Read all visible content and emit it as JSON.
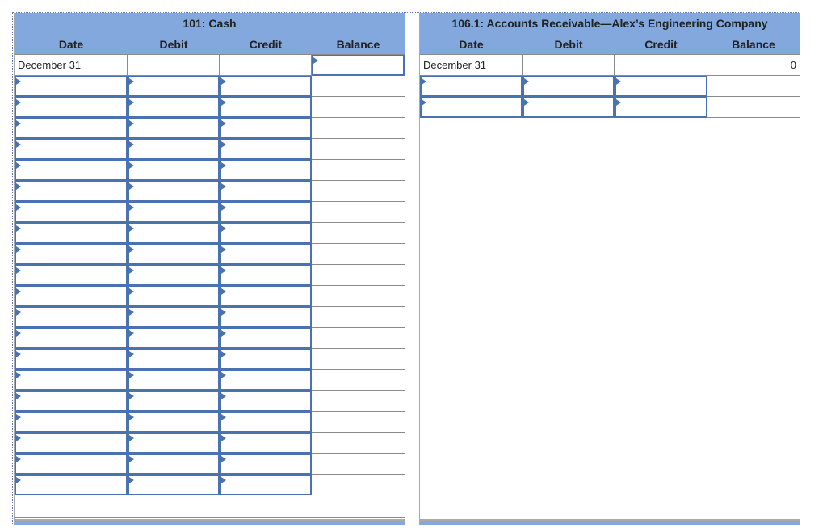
{
  "columns": [
    "Date",
    "Debit",
    "Credit",
    "Balance"
  ],
  "accent_color": "#82a8de",
  "input_border_color": "#4a72b0",
  "accounts": [
    {
      "title": "101: Cash",
      "rows": [
        {
          "values": [
            "December 31",
            "",
            "",
            ""
          ],
          "editable": [
            false,
            false,
            false,
            true
          ]
        },
        {
          "values": [
            "",
            "",
            "",
            ""
          ],
          "editable": [
            true,
            true,
            true,
            false
          ]
        },
        {
          "values": [
            "",
            "",
            "",
            ""
          ],
          "editable": [
            true,
            true,
            true,
            false
          ]
        },
        {
          "values": [
            "",
            "",
            "",
            ""
          ],
          "editable": [
            true,
            true,
            true,
            false
          ]
        },
        {
          "values": [
            "",
            "",
            "",
            ""
          ],
          "editable": [
            true,
            true,
            true,
            false
          ]
        },
        {
          "values": [
            "",
            "",
            "",
            ""
          ],
          "editable": [
            true,
            true,
            true,
            false
          ]
        },
        {
          "values": [
            "",
            "",
            "",
            ""
          ],
          "editable": [
            true,
            true,
            true,
            false
          ]
        },
        {
          "values": [
            "",
            "",
            "",
            ""
          ],
          "editable": [
            true,
            true,
            true,
            false
          ]
        },
        {
          "values": [
            "",
            "",
            "",
            ""
          ],
          "editable": [
            true,
            true,
            true,
            false
          ]
        },
        {
          "values": [
            "",
            "",
            "",
            ""
          ],
          "editable": [
            true,
            true,
            true,
            false
          ]
        },
        {
          "values": [
            "",
            "",
            "",
            ""
          ],
          "editable": [
            true,
            true,
            true,
            false
          ]
        },
        {
          "values": [
            "",
            "",
            "",
            ""
          ],
          "editable": [
            true,
            true,
            true,
            false
          ]
        },
        {
          "values": [
            "",
            "",
            "",
            ""
          ],
          "editable": [
            true,
            true,
            true,
            false
          ]
        },
        {
          "values": [
            "",
            "",
            "",
            ""
          ],
          "editable": [
            true,
            true,
            true,
            false
          ]
        },
        {
          "values": [
            "",
            "",
            "",
            ""
          ],
          "editable": [
            true,
            true,
            true,
            false
          ]
        },
        {
          "values": [
            "",
            "",
            "",
            ""
          ],
          "editable": [
            true,
            true,
            true,
            false
          ]
        },
        {
          "values": [
            "",
            "",
            "",
            ""
          ],
          "editable": [
            true,
            true,
            true,
            false
          ]
        },
        {
          "values": [
            "",
            "",
            "",
            ""
          ],
          "editable": [
            true,
            true,
            true,
            false
          ]
        },
        {
          "values": [
            "",
            "",
            "",
            ""
          ],
          "editable": [
            true,
            true,
            true,
            false
          ]
        },
        {
          "values": [
            "",
            "",
            "",
            ""
          ],
          "editable": [
            true,
            true,
            true,
            false
          ]
        },
        {
          "values": [
            "",
            "",
            "",
            ""
          ],
          "editable": [
            true,
            true,
            true,
            false
          ]
        }
      ]
    },
    {
      "title": "106.1: Accounts Receivable—Alex’s Engineering Company",
      "rows": [
        {
          "values": [
            "December 31",
            "",
            "",
            "0"
          ],
          "editable": [
            false,
            false,
            false,
            false
          ]
        },
        {
          "values": [
            "",
            "",
            "",
            ""
          ],
          "editable": [
            true,
            true,
            true,
            false
          ]
        },
        {
          "values": [
            "",
            "",
            "",
            ""
          ],
          "editable": [
            true,
            true,
            true,
            false
          ]
        }
      ]
    }
  ]
}
